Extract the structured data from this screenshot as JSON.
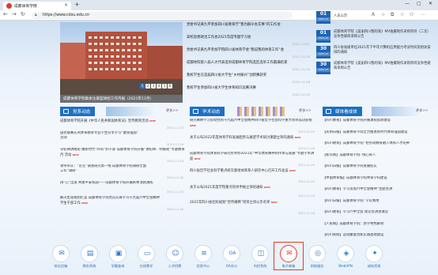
{
  "browser": {
    "tab_title": "成都体育学院",
    "new_tab": "+",
    "url": "https://www.cdsu.edu.cn",
    "window_controls": [
      "—",
      "▢",
      "✕"
    ],
    "nav": [
      "←",
      "→",
      "↻"
    ],
    "toolbar_icons": [
      "A",
      "☆",
      "⧉",
      "☆",
      "⚇",
      "⋯"
    ]
  },
  "headline": {
    "caption": "成都体育学院集体注册篮球招工作月报（2021年11月）",
    "pages": [
      "1",
      "2",
      "3",
      "4",
      "5",
      "6"
    ],
    "active_page": "1"
  },
  "news": [
    {
      "title": "党委书记黄九平参加四川省教育厅“我为群众办实事”的工作会",
      "date": ""
    },
    {
      "title": "高校思想政治工作会2021年度专题学习会",
      "date": "2021-12-01"
    },
    {
      "title": "党委书记黄九平参加学院四川省体育学会“我说我的体育工作”会",
      "date": "2021-11-26"
    },
    {
      "title": "成都体院第八届人大代表选举成都体育学院选区选举工作圆满结束",
      "date": "2021-11-30"
    },
    {
      "title": "我校学生在首届四川省大学生“乡村振兴”创新赛获奖",
      "date": "2021-11-26"
    },
    {
      "title": "我校学生参加四川省大学生体育知识竞赛决赛",
      "date": "2021-11-22"
    }
  ],
  "dated": [
    {
      "day": "01",
      "ym": "2021-12",
      "title": "人员公示"
    },
    {
      "day": "01",
      "ym": "2021-12",
      "title": "成都体育学院《美丽四川我的家》MV拍摄制作采购项目（二次）竞争性磋商采购公告"
    },
    {
      "day": "30",
      "ym": "2021-11",
      "title": "四川省省级单位2021年下半年计算机应用能力考试时间及相关安排的通知"
    },
    {
      "day": "30",
      "ym": "2021-11",
      "title": "成都体育学院《美丽四川我的家》MV拍摄制作采购项目竞争性磋商采购公告"
    }
  ],
  "sections": {
    "party": {
      "label": "党系动态",
      "more": "更多>>"
    },
    "study": {
      "label": "学术动态",
      "more": "更多>>"
    },
    "media": {
      "label": "媒体看成体",
      "more": "更多>>"
    }
  },
  "party_list": [
    {
      "title": "成都体育学院开展《中华人民共和国体育法》宣传教育活动",
      "date": "2021-11-23",
      "new": "NEW"
    },
    {
      "title": "田径联赛东风体育教育专业学生分享学习“健身强国”",
      "title2": "活动",
      "date": "2021-11-26",
      "new": ""
    },
    {
      "title": "守纪律讲规矩 做新时代“四有”好干部 成都体育学院开展“讲纪律、明规矩”专题教育月 活动",
      "date": "2021-11-23",
      "new": "NEW"
    },
    {
      "title": "领导带头：“走在”调查研究第一线 成都体育学院调研全面",
      "title2": "工作“调研”",
      "date": "2021-11-20",
      "new": ""
    },
    {
      "title": "再“心”出发 共建平安校园——成都体育学院开展秋季消防演练",
      "date": "2021-11-20",
      "new": ""
    },
    {
      "title": "解决生涯规划打造 成都体育学院党员先锋学习十九届六中全会精神",
      "title2": "学生干部工作",
      "date": "2021-11-16",
      "new": "NEW"
    }
  ],
  "study_list": [
    {
      "title": "研究阐释学习贯彻党的十九届六中全会精神四川省哲学社会科学重大项目成功获批",
      "date": "2021-11-29",
      "new": "NEW"
    },
    {
      "title": "关于公布2022年度体育学科发展趋势与展望学术研讨课题立项的通知",
      "date": "2021-11-26",
      "new": "NEW"
    },
    {
      "title": "成都体育学院体育科学研究所举办2021年“中华体育精神的传承与发展”专题学术讲座",
      "date": "2021-11-25",
      "new": "NEW"
    },
    {
      "title": "四川省哲学社会科学重点研究基地体育育人研究中心召开工作会议",
      "date": "2021-11-20",
      "new": "NEW"
    },
    {
      "title": "关于公布2021年度学院重点项目申报立项的通知",
      "date": "2021-11-19",
      "new": "NEW"
    },
    {
      "title": "2021年四川省社科规划“宣传阐释”项目立项公示名单",
      "date": "2021-11-18",
      "new": "NEW"
    }
  ],
  "media_list": [
    {
      "title": "【四川教育】成都体育学院开展课程思政建设"
    },
    {
      "title": "【光明日报】成都体育学院全力推进新时代体育强国建设"
    },
    {
      "title": "【四川教育】成都体育学院: 把劳动教育融入体育人才培养"
    },
    {
      "title": "【新华网】成都体育学院: 倾心育人"
    },
    {
      "title": "【四川日报】成都体育学院发展纪实"
    },
    {
      "title": "【中国体育报】成都体育学院体育学科建设"
    },
    {
      "title": "【四川教育】学习贯彻六中全会精神”主题宣讲"
    },
    {
      "title": "【四川日报】成都体育学院: 学以致用"
    },
    {
      "title": "【四川教育】学习六中全会 理论宣讲进课堂"
    },
    {
      "title": "【人民网】成都体育学院：办学特色鲜明"
    },
    {
      "title": "【四川新闻】运动康复创新实践基地建设"
    }
  ],
  "quick_links": [
    {
      "label": "校长信箱",
      "icon": "mail-icon",
      "glyph": "✉"
    },
    {
      "label": "教务系统",
      "icon": "book-icon",
      "glyph": "▤"
    },
    {
      "label": "学籍查询",
      "icon": "id-icon",
      "glyph": "▣"
    },
    {
      "label": "在线教学",
      "icon": "monitor-icon",
      "glyph": "▭"
    },
    {
      "label": "人才招聘",
      "icon": "user-icon",
      "glyph": "☺"
    },
    {
      "label": "信息中心",
      "icon": "server-icon",
      "glyph": "≡"
    },
    {
      "label": "OA办公",
      "icon": "oa-icon",
      "glyph": "OA"
    },
    {
      "label": "内控系统",
      "icon": "lock-icon",
      "glyph": "◫"
    },
    {
      "label": "电子邮箱",
      "icon": "envelope-icon",
      "glyph": "✉"
    },
    {
      "label": "网络服务",
      "icon": "globe-icon",
      "glyph": "◎"
    },
    {
      "label": "WebVPN",
      "icon": "shield-icon",
      "glyph": "◈"
    },
    {
      "label": "成体资源",
      "icon": "star-icon",
      "glyph": "✦"
    }
  ],
  "colors": {
    "primary": "#1d6fc4",
    "accent_new": "#e23b2e",
    "date_box": "#2063b2"
  }
}
